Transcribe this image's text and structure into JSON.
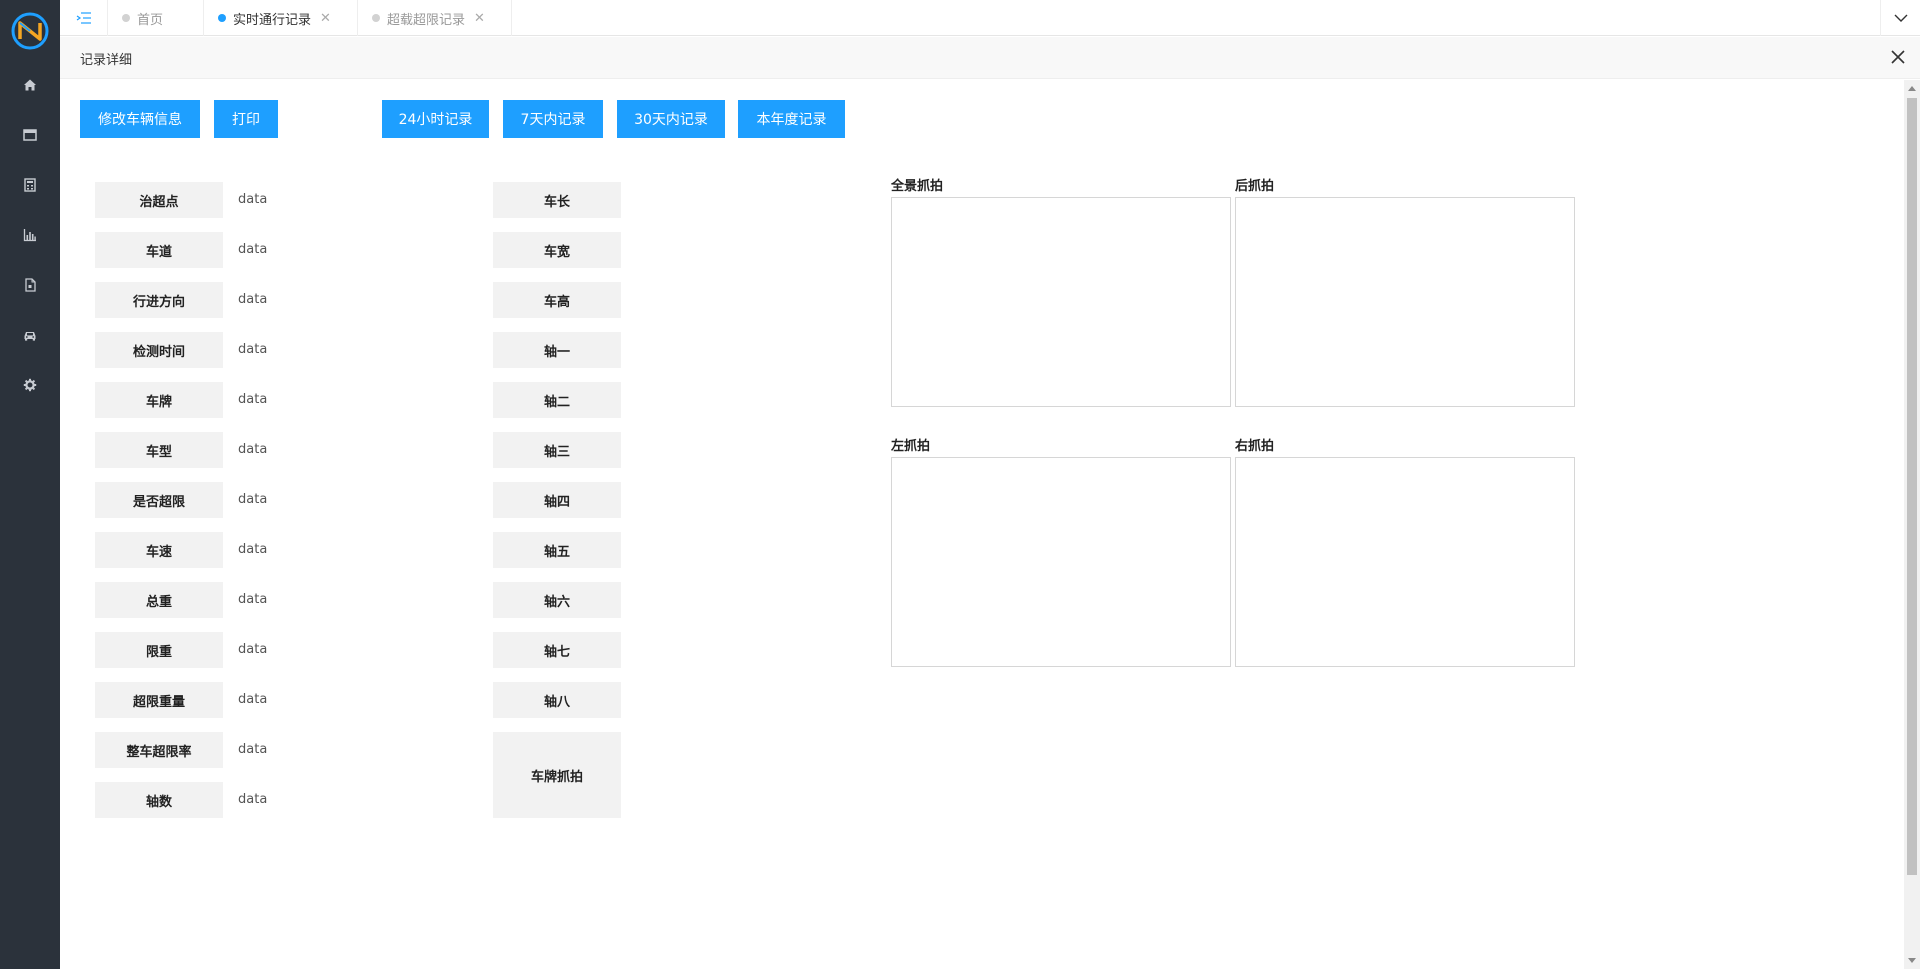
{
  "sidebar": {
    "logo_letter": "N",
    "items": [
      {
        "icon": "home-icon"
      },
      {
        "icon": "window-icon"
      },
      {
        "icon": "calculator-icon"
      },
      {
        "icon": "bar-chart-icon"
      },
      {
        "icon": "document-icon"
      },
      {
        "icon": "car-icon"
      },
      {
        "icon": "gear-icon"
      }
    ]
  },
  "tabs": [
    {
      "label": "首页",
      "active": false,
      "closable": false
    },
    {
      "label": "实时通行记录",
      "active": true,
      "closable": true
    },
    {
      "label": "超载超限记录",
      "active": false,
      "closable": true
    }
  ],
  "dialog": {
    "title": "记录详细"
  },
  "buttons": {
    "edit_vehicle": "修改车辆信息",
    "print": "打印",
    "last_24h": "24小时记录",
    "last_7d": "7天内记录",
    "last_30d": "30天内记录",
    "this_year": "本年度记录"
  },
  "fields_left": [
    {
      "label": "治超点",
      "value": "data"
    },
    {
      "label": "车道",
      "value": "data"
    },
    {
      "label": "行进方向",
      "value": "data"
    },
    {
      "label": "检测时间",
      "value": "data"
    },
    {
      "label": "车牌",
      "value": "data"
    },
    {
      "label": "车型",
      "value": "data"
    },
    {
      "label": "是否超限",
      "value": "data"
    },
    {
      "label": "车速",
      "value": "data"
    },
    {
      "label": "总重",
      "value": "data"
    },
    {
      "label": "限重",
      "value": "data"
    },
    {
      "label": "超限重量",
      "value": "data"
    },
    {
      "label": "整车超限率",
      "value": "data"
    },
    {
      "label": "轴数",
      "value": "data"
    }
  ],
  "fields_right": [
    {
      "label": "车长"
    },
    {
      "label": "车宽"
    },
    {
      "label": "车高"
    },
    {
      "label": "轴一"
    },
    {
      "label": "轴二"
    },
    {
      "label": "轴三"
    },
    {
      "label": "轴四"
    },
    {
      "label": "轴五"
    },
    {
      "label": "轴六"
    },
    {
      "label": "轴七"
    },
    {
      "label": "轴八"
    },
    {
      "label": "车牌抓拍"
    }
  ],
  "photos": {
    "panorama": "全景抓拍",
    "rear": "后抓拍",
    "left": "左抓拍",
    "right": "右抓拍"
  },
  "colors": {
    "sidebar_bg": "#2b323b",
    "accent": "#1e9fff",
    "label_bg": "#f2f2f2"
  }
}
